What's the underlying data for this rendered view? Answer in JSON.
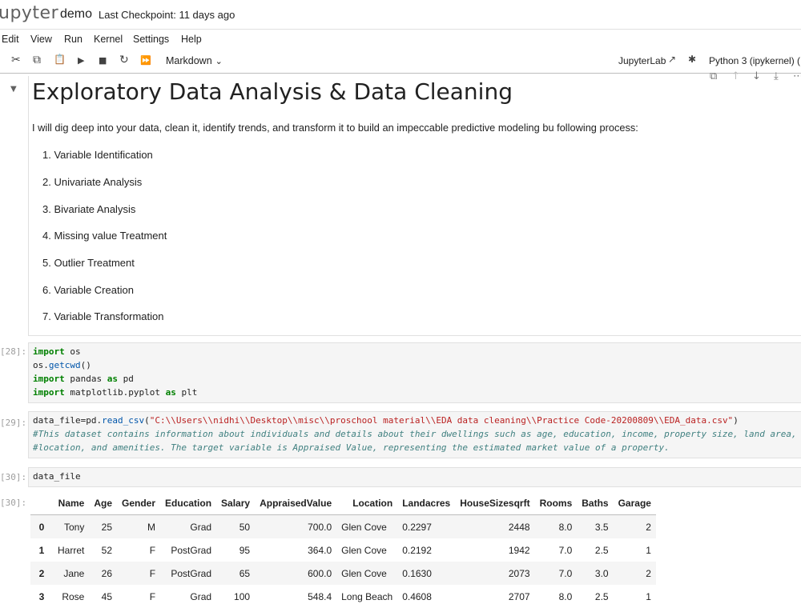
{
  "header": {
    "logo": "upyter",
    "notebook_name": "demo",
    "checkpoint": "Last Checkpoint: 11 days ago"
  },
  "menu": [
    "Edit",
    "View",
    "Run",
    "Kernel",
    "Settings",
    "Help"
  ],
  "toolbar": {
    "cell_type": "Markdown",
    "jupyterlab_label": "JupyterLab",
    "kernel_label": "Python 3 (ipykernel)",
    "kernel_status": "("
  },
  "markdown_cell": {
    "title": "Exploratory Data Analysis & Data Cleaning",
    "paragraph": "I will dig deep into your data, clean it, identify trends, and transform it to build an impeccable predictive modeling bu following process:",
    "steps": [
      "1. Variable Identification",
      "2. Univariate Analysis",
      "3. Bivariate Analysis",
      "4. Missing value Treatment",
      "5. Outlier Treatment",
      "6. Variable Creation",
      "7. Variable Transformation"
    ]
  },
  "cells": {
    "c128": {
      "prompt": "[28]:",
      "l1_kw": "import",
      "l1_rest": " os",
      "l2_a": "os.",
      "l2_fn": "getcwd",
      "l2_b": "()",
      "l3_kw": "import",
      "l3_mid": " pandas ",
      "l3_kw2": "as",
      "l3_rest": " pd",
      "l4_kw": "import",
      "l4_mid": " matplotlib.pyplot ",
      "l4_kw2": "as",
      "l4_rest": " plt"
    },
    "c129": {
      "prompt": "[29]:",
      "l1_a": "data_file=pd.",
      "l1_fn": "read_csv",
      "l1_b": "(",
      "l1_str": "\"C:\\\\Users\\\\nidhi\\\\Desktop\\\\misc\\\\proschool material\\\\EDA data cleaning\\\\Practice Code-20200809\\\\EDA_data.csv\"",
      "l1_c": ")",
      "l2_cmt": "#This dataset contains information about individuals and details about their dwellings such as age, education, income, property size, land area,",
      "l3_cmt": "#location, and amenities. The target variable is Appraised Value, representing the estimated market value of a property."
    },
    "c130": {
      "prompt": "[30]:",
      "code": "data_file",
      "out_prompt": "[30]:"
    }
  },
  "dataframe": {
    "columns": [
      "Name",
      "Age",
      "Gender",
      "Education",
      "Salary",
      "AppraisedValue",
      "Location",
      "Landacres",
      "HouseSizesqrft",
      "Rooms",
      "Baths",
      "Garage"
    ],
    "rows": [
      [
        "0",
        "Tony",
        "25",
        "M",
        "Grad",
        "50",
        "700.0",
        "Glen Cove",
        "0.2297",
        "2448",
        "8.0",
        "3.5",
        "2"
      ],
      [
        "1",
        "Harret",
        "52",
        "F",
        "PostGrad",
        "95",
        "364.0",
        "Glen Cove",
        "0.2192",
        "1942",
        "7.0",
        "2.5",
        "1"
      ],
      [
        "2",
        "Jane",
        "26",
        "F",
        "PostGrad",
        "65",
        "600.0",
        "Glen Cove",
        "0.1630",
        "2073",
        "7.0",
        "3.0",
        "2"
      ],
      [
        "3",
        "Rose",
        "45",
        "F",
        "Grad",
        "100",
        "548.4",
        "Long Beach",
        "0.4608",
        "2707",
        "8.0",
        "2.5",
        "1"
      ]
    ]
  },
  "icons": {
    "cut": "✂",
    "copy": "⧉",
    "paste": "📋",
    "run": "▶",
    "stop": "■",
    "restart": "↻",
    "fast_forward": "⏩",
    "external": "↗",
    "bug": "✱",
    "cell_copy": "⧉",
    "move_up": "↑",
    "move_down": "↓",
    "insert_below": "⤓",
    "more": "⋯",
    "collapse": "▼"
  }
}
